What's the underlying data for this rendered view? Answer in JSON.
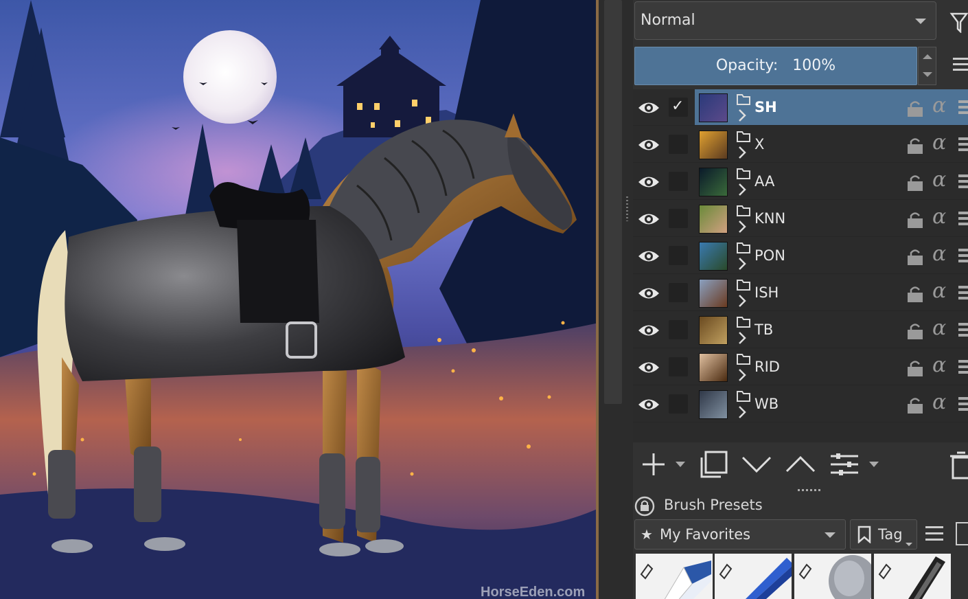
{
  "canvas": {
    "watermark": "HorseEden.com"
  },
  "layers_panel": {
    "blend_mode": "Normal",
    "opacity_label": "Opacity:",
    "opacity_value": "100%",
    "layers": [
      {
        "name": "SH",
        "selected": true,
        "checked": true
      },
      {
        "name": "X",
        "selected": false,
        "checked": false
      },
      {
        "name": "AA",
        "selected": false,
        "checked": false
      },
      {
        "name": "KNN",
        "selected": false,
        "checked": false
      },
      {
        "name": "PON",
        "selected": false,
        "checked": false
      },
      {
        "name": "ISH",
        "selected": false,
        "checked": false
      },
      {
        "name": "TB",
        "selected": false,
        "checked": false
      },
      {
        "name": "RID",
        "selected": false,
        "checked": false
      },
      {
        "name": "WB",
        "selected": false,
        "checked": false
      }
    ],
    "toolbar_icons": [
      "add-layer-icon",
      "duplicate-layer-icon",
      "move-down-icon",
      "move-up-icon",
      "layer-properties-icon",
      "delete-layer-icon"
    ]
  },
  "brush_presets": {
    "title": "Brush Presets",
    "tag_filter": "My Favorites",
    "tag_button": "Tag",
    "brushes": [
      "eraser-brush",
      "marker-brush",
      "airbrush-brush",
      "pen-brush"
    ]
  },
  "colors": {
    "selection": "#4e7396",
    "panel_bg": "#323232",
    "layer_list_bg": "#2b2b2b"
  }
}
